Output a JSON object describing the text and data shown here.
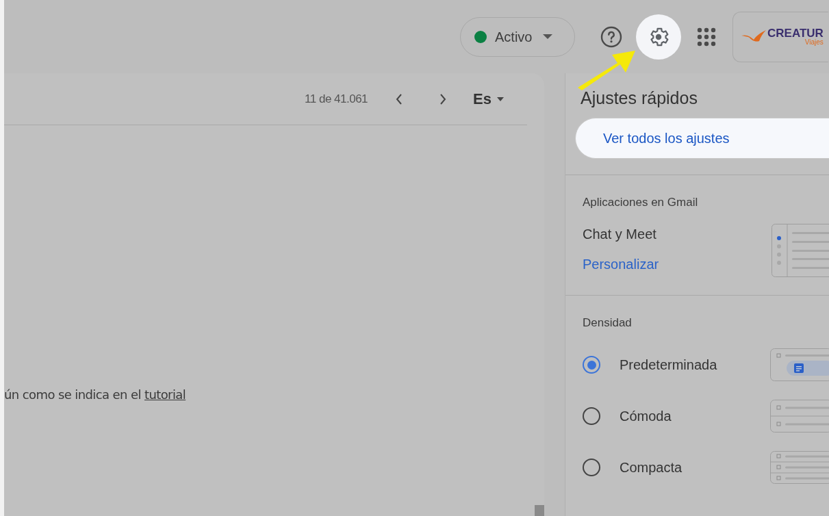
{
  "header": {
    "status": {
      "label": "Activo"
    },
    "logo": {
      "name": "CREATUR",
      "tagline": "Viajes"
    }
  },
  "toolbar": {
    "count": "11 de 41.061",
    "input_tool": "Es"
  },
  "message": {
    "text": "ún como se indica en el",
    "link": "tutorial"
  },
  "quick_settings": {
    "title": "Ajustes rápidos",
    "all_settings_button": "Ver todos los ajustes",
    "apps": {
      "heading": "Aplicaciones en Gmail",
      "label": "Chat y Meet",
      "link": "Personalizar"
    },
    "density": {
      "heading": "Densidad",
      "options": [
        {
          "label": "Predeterminada",
          "selected": true,
          "kind": "default"
        },
        {
          "label": "Cómoda",
          "selected": false,
          "kind": "comfortable"
        },
        {
          "label": "Compacta",
          "selected": false,
          "kind": "compact"
        }
      ]
    }
  }
}
